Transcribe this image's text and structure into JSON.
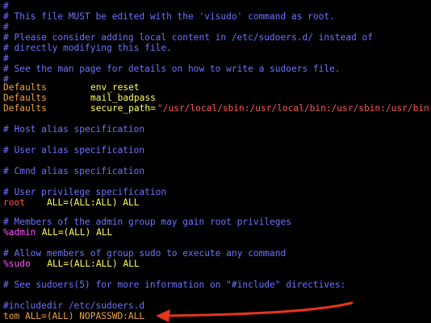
{
  "file": {
    "lines": [
      "#",
      "# This file MUST be edited with the 'visudo' command as root.",
      "#",
      "# Please consider adding local content in /etc/sudoers.d/ instead of",
      "# directly modifying this file.",
      "#",
      "# See the man page for details on how to write a sudoers file.",
      "#",
      "Defaults",
      "env_reset",
      "Defaults",
      "mail_badpass",
      "Defaults",
      "secure_path=",
      "\"/usr/local/sbin:/usr/local/bin:/usr/sbin:/usr/bin:/",
      "# Host alias specification",
      "# User alias specification",
      "# Cmnd alias specification",
      "# User privilege specification",
      "root",
      "ALL=(ALL:ALL) ALL",
      "# Members of the admin group may gain root privileges",
      "%admin",
      " ALL=(ALL) ALL",
      "# Allow members of group sudo to execute any command",
      "%sudo",
      "   ALL=(ALL:ALL) ALL",
      "# See sudoers(5) for more information on \"#include\" directives:",
      "#includedir /etc/sudoers.d",
      "tom ALL=(ALL) NOPASSWD:ALL"
    ]
  },
  "colors": {
    "background": "#000000",
    "comment": "#6f72ff",
    "keyword": "#f0a33a",
    "value": "#ffff54",
    "group": "#ff55ff",
    "user": "#ff5656",
    "annotation_arrow": "#e8341c"
  },
  "annotation": {
    "icon": "red-arrow-icon"
  }
}
